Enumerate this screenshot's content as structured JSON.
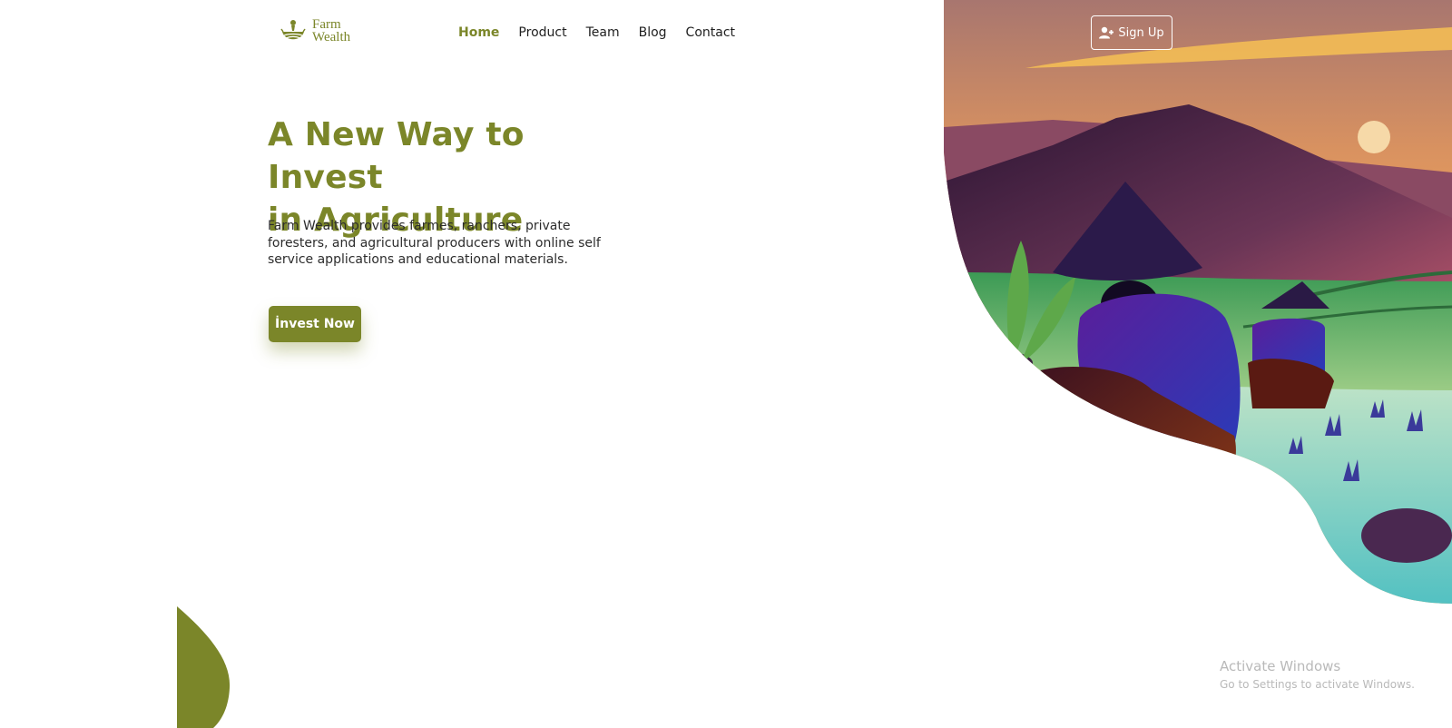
{
  "brand": {
    "line1": "Farm",
    "line2": "Wealth",
    "logo_icon": "farm-basket-icon"
  },
  "nav": {
    "items": [
      {
        "label": "Home",
        "active": true
      },
      {
        "label": "Product",
        "active": false
      },
      {
        "label": "Team",
        "active": false
      },
      {
        "label": "Blog",
        "active": false
      },
      {
        "label": "Contact",
        "active": false
      }
    ]
  },
  "signup": {
    "label": "Sign Up",
    "icon": "user-plus-icon"
  },
  "hero": {
    "title_line1": "A New Way to Invest",
    "title_line2": "in Agriculture",
    "description": "Farm Wealth provides farmes, ranchers, private foresters, and agricultural producers with online self service applications and educational materials.",
    "cta_label": "İnvest Now"
  },
  "watermark": {
    "title": "Activate Windows",
    "subtitle": "Go to Settings to activate Windows."
  },
  "colors": {
    "accent": "#7b8629",
    "sky_top": "#b17a77",
    "sky_bottom": "#f0a95a",
    "mountain": "#3a1d3c",
    "water": "#5ec6c0",
    "shirt": "#3a2aa0"
  }
}
